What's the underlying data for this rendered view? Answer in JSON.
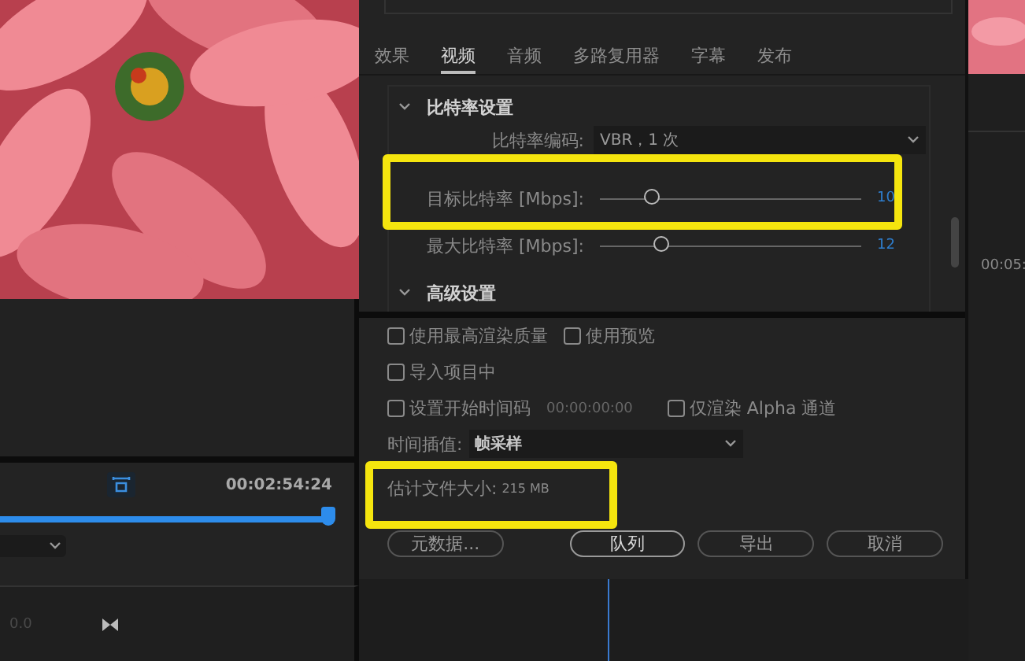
{
  "preview": {
    "timecode": "00:02:54:24",
    "level": 0.975,
    "track_value": "0.0"
  },
  "export_dialog": {
    "tabs": [
      {
        "label": "效果",
        "selected": false
      },
      {
        "label": "视频",
        "selected": true
      },
      {
        "label": "音频",
        "selected": false
      },
      {
        "label": "多路复用器",
        "selected": false
      },
      {
        "label": "字幕",
        "selected": false
      },
      {
        "label": "发布",
        "selected": false
      }
    ],
    "bitrate_section": {
      "title": "比特率设置",
      "expanded": true,
      "encoding_label": "比特率编码:",
      "encoding_value": "VBR，1 次",
      "sliders": [
        {
          "label": "目标比特率 [Mbps]:",
          "level": 0.2,
          "reading": "10"
        },
        {
          "label": "最大比特率 [Mbps]:",
          "level": 0.235,
          "reading": "12"
        }
      ]
    },
    "advanced_section": {
      "title": "高级设置",
      "expanded": true
    },
    "option_rows": [
      [
        {
          "label": "使用最高渲染质量",
          "checked": false
        },
        {
          "label": "使用预览",
          "checked": false
        }
      ],
      [
        {
          "label": "导入项目中",
          "checked": false
        }
      ],
      [
        {
          "label": "设置开始时间码",
          "checked": false,
          "value": "00:00:00:00"
        },
        {
          "label": "仅渲染 Alpha 通道",
          "checked": false
        }
      ]
    ],
    "time_interpolation": {
      "label": "时间插值:",
      "value": "帧采样"
    },
    "file_size": {
      "label": "估计文件大小:",
      "value": "215 MB"
    },
    "buttons": [
      {
        "label": "元数据...",
        "kind": "secondary"
      },
      {
        "label": "队列",
        "kind": "primary"
      },
      {
        "label": "导出",
        "kind": "secondary"
      },
      {
        "label": "取消",
        "kind": "secondary"
      }
    ]
  },
  "right_panel": {
    "timecode": "00:05:"
  },
  "highlights": [
    {
      "kind": "box"
    },
    {
      "kind": "box"
    }
  ]
}
